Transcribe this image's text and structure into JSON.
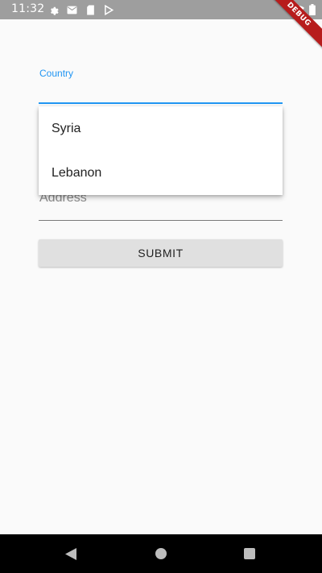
{
  "status_bar": {
    "time": "11:32",
    "icons": [
      "gear-icon",
      "mail-icon",
      "sd-card-icon",
      "play-store-icon",
      "wifi-icon",
      "battery-icon"
    ]
  },
  "debug_banner": {
    "label": "DEBUG"
  },
  "form": {
    "country_label": "Country",
    "address_placeholder": "Address",
    "submit_label": "SUBMIT"
  },
  "dropdown": {
    "options": [
      "Syria",
      "Lebanon"
    ]
  },
  "colors": {
    "accent": "#2196f3",
    "status_bar": "#9e9e9e",
    "background": "#fafafa",
    "button": "#e0e0e0",
    "debug": "#b71c1c"
  }
}
